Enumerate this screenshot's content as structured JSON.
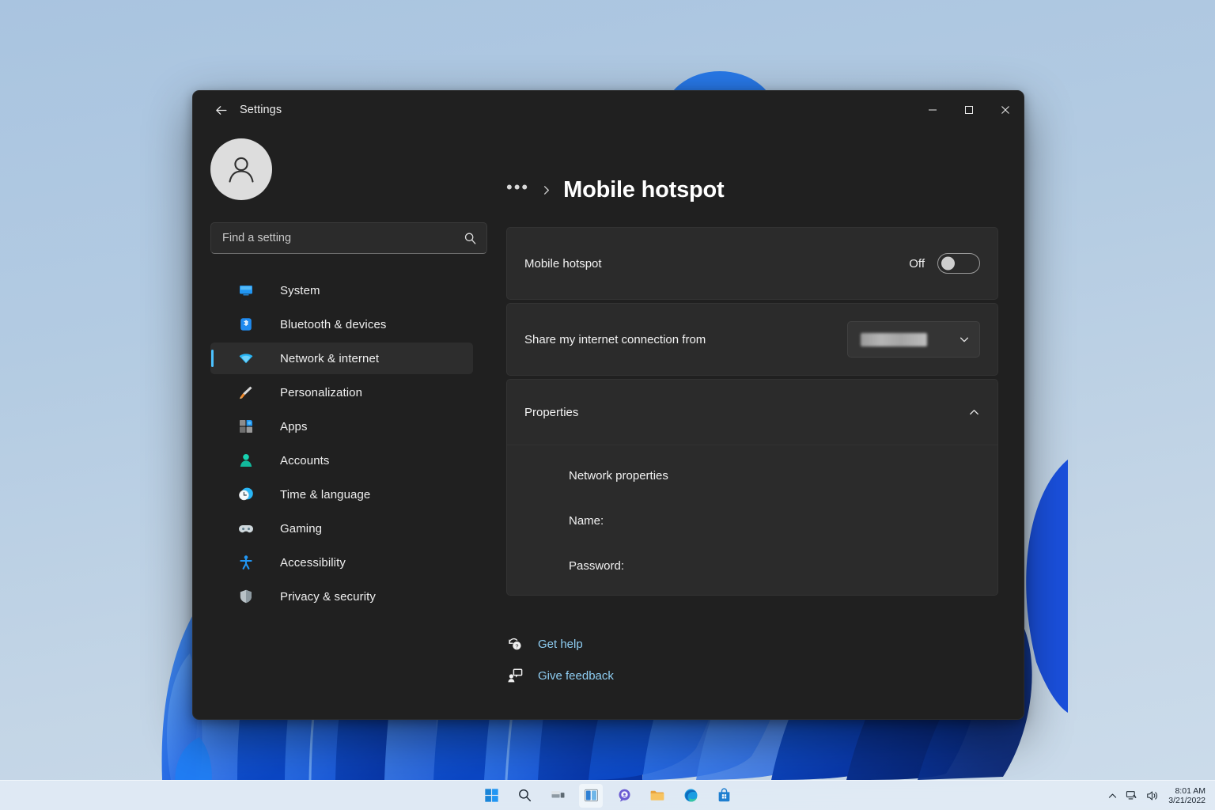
{
  "window": {
    "app_title": "Settings",
    "back_icon": "arrow-left-icon",
    "controls": {
      "minimize_label": "Minimize",
      "maximize_label": "Maximize",
      "close_label": "Close"
    }
  },
  "sidebar": {
    "avatar_icon": "user-avatar-icon",
    "search": {
      "placeholder": "Find a setting",
      "value": "",
      "icon": "search-icon"
    },
    "items": [
      {
        "label": "System",
        "icon": "system-monitor-icon",
        "selected": false
      },
      {
        "label": "Bluetooth & devices",
        "icon": "bluetooth-icon",
        "selected": false
      },
      {
        "label": "Network & internet",
        "icon": "wifi-icon",
        "selected": true
      },
      {
        "label": "Personalization",
        "icon": "paintbrush-icon",
        "selected": false
      },
      {
        "label": "Apps",
        "icon": "apps-grid-icon",
        "selected": false
      },
      {
        "label": "Accounts",
        "icon": "person-icon",
        "selected": false
      },
      {
        "label": "Time & language",
        "icon": "clock-icon",
        "selected": false
      },
      {
        "label": "Gaming",
        "icon": "gamepad-icon",
        "selected": false
      },
      {
        "label": "Accessibility",
        "icon": "accessibility-icon",
        "selected": false
      },
      {
        "label": "Privacy & security",
        "icon": "shield-icon",
        "selected": false
      }
    ]
  },
  "main": {
    "breadcrumb": {
      "overflow": "•••",
      "separator_icon": "chevron-right-icon",
      "title": "Mobile hotspot"
    },
    "hotspot": {
      "label": "Mobile hotspot",
      "state_label": "Off",
      "enabled": false
    },
    "share_from": {
      "label": "Share my internet connection from",
      "value": "",
      "value_redacted": true,
      "chevron_icon": "chevron-down-icon"
    },
    "properties": {
      "title": "Properties",
      "expanded": true,
      "collapse_icon": "chevron-up-icon",
      "section_title": "Network properties",
      "fields": [
        {
          "label": "Name:",
          "value": ""
        },
        {
          "label": "Password:",
          "value": ""
        }
      ]
    },
    "links": [
      {
        "label": "Get help",
        "icon": "help-question-icon"
      },
      {
        "label": "Give feedback",
        "icon": "feedback-icon"
      }
    ]
  },
  "taskbar": {
    "buttons": [
      {
        "name": "start",
        "icon": "windows-logo-icon",
        "active": false
      },
      {
        "name": "search",
        "icon": "search-icon",
        "active": false
      },
      {
        "name": "task-view",
        "icon": "task-view-icon",
        "active": false
      },
      {
        "name": "widgets",
        "icon": "widgets-icon",
        "active": true
      },
      {
        "name": "chat",
        "icon": "chat-icon",
        "active": false
      },
      {
        "name": "file-explorer",
        "icon": "folder-icon",
        "active": false
      },
      {
        "name": "edge",
        "icon": "edge-browser-icon",
        "active": false
      },
      {
        "name": "microsoft-store",
        "icon": "store-bag-icon",
        "active": false
      }
    ],
    "tray": {
      "overflow_icon": "chevron-up-icon",
      "network_icon": "network-icon",
      "volume_icon": "volume-icon",
      "time": "8:01 AM",
      "date": "3/21/2022"
    }
  },
  "colors": {
    "accent": "#4cc2ff",
    "link": "#8ecdf2",
    "window_bg": "#202020",
    "card_bg": "#2b2b2b",
    "desktop_bg": "#b3cbe2"
  }
}
